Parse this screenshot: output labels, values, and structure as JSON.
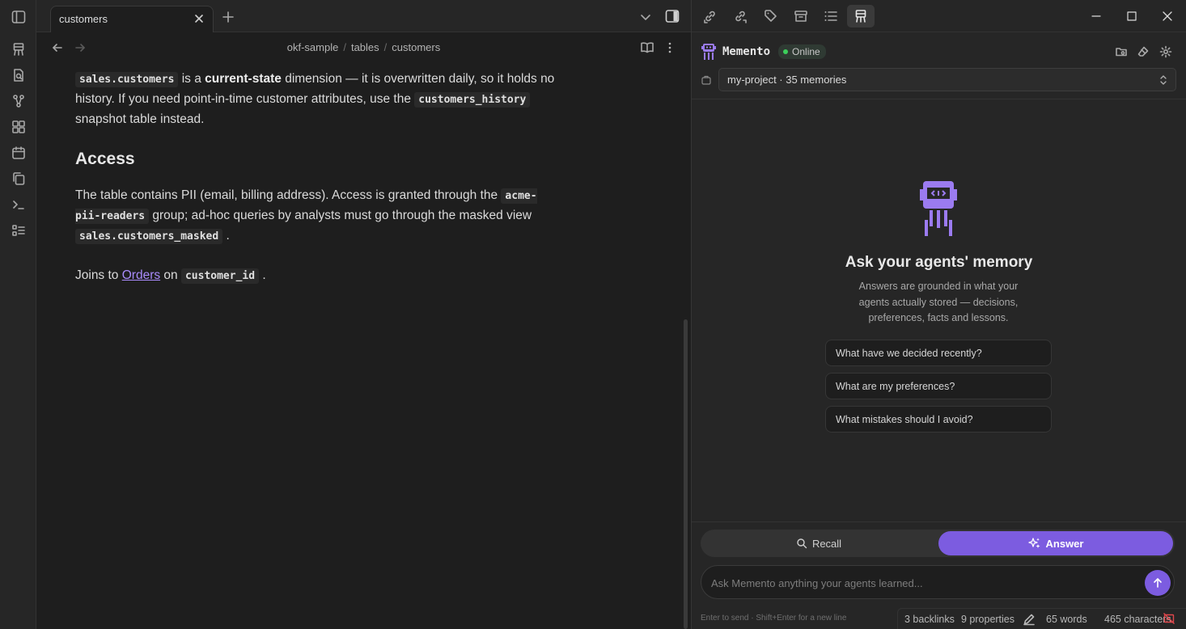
{
  "tab": {
    "title": "customers"
  },
  "breadcrumb": {
    "parts": [
      "okf-sample",
      "tables",
      "customers"
    ],
    "separator": "/"
  },
  "doc": {
    "p1": {
      "code1": "sales.customers",
      "t1": " is a ",
      "bold1": "current-state",
      "t2": " dimension — it is overwritten daily, so it holds no history. If you need point-in-time customer attributes, use the ",
      "code2": "customers_history",
      "t3": " snapshot table instead."
    },
    "heading": "Access",
    "p2": {
      "t1": "The table contains PII (email, billing address). Access is granted through the ",
      "code1": "acme-pii-readers",
      "t2": " group; ad-hoc queries by analysts must go through the masked view ",
      "code2": "sales.customers_masked",
      "t3": " ."
    },
    "p3": {
      "t1": "Joins to ",
      "link": "Orders",
      "t2": " on ",
      "code1": "customer_id",
      "t3": " ."
    }
  },
  "memento": {
    "title": "Memento",
    "status": "Online",
    "project": "my-project · 35 memories",
    "empty_title": "Ask your agents' memory",
    "empty_desc": "Answers are grounded in what your agents actually stored — decisions, preferences, facts and lessons.",
    "suggestions": [
      "What have we decided recently?",
      "What are my preferences?",
      "What mistakes should I avoid?"
    ],
    "modes": {
      "recall": "Recall",
      "answer": "Answer"
    },
    "input_placeholder": "Ask Memento anything your agents learned...",
    "hint": "Enter to send · Shift+Enter for a new line"
  },
  "statusbar": {
    "backlinks": "3 backlinks",
    "properties": "9 properties",
    "words": "65 words",
    "characters": "465 characters"
  },
  "colors": {
    "accent": "#7c5ce0",
    "link": "#a88bfa",
    "online": "#3ccf5b",
    "background": "#1e1e1e",
    "panel": "#262626"
  }
}
